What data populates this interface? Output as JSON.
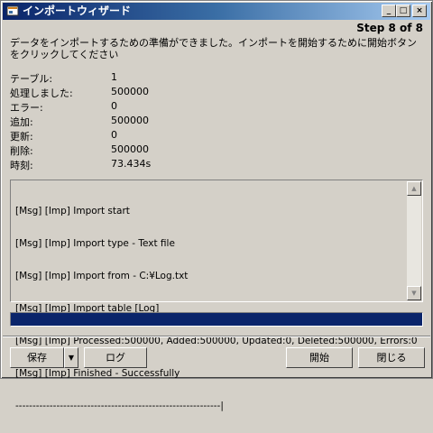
{
  "window": {
    "title": "インポートウィザード",
    "min": "_",
    "max": "□",
    "close": "×"
  },
  "step": "Step 8 of 8",
  "instruction": "データをインポートするための準備ができました。インポートを開始するために開始ボタンをクリックしてください",
  "stats": [
    {
      "label": "テーブル:",
      "value": "1"
    },
    {
      "label": "処理しました:",
      "value": "500000"
    },
    {
      "label": "エラー:",
      "value": "0"
    },
    {
      "label": "追加:",
      "value": "500000"
    },
    {
      "label": "更新:",
      "value": "0"
    },
    {
      "label": "削除:",
      "value": "500000"
    },
    {
      "label": "時刻:",
      "value": "73.434s"
    }
  ],
  "log": [
    "[Msg] [Imp] Import start",
    "[Msg] [Imp] Import type - Text file",
    "[Msg] [Imp] Import from - C:¥Log.txt",
    "[Msg] [Imp] Import table [Log]",
    "[Msg] [Imp] Processed:500000, Added:500000, Updated:0, Deleted:500000, Errors:0",
    "[Msg] [Imp] Finished - Successfully",
    "------------------------------------------------------------|"
  ],
  "progress": 1.0,
  "buttons": {
    "save": "保存",
    "save_arrow": "▼",
    "log": "ログ",
    "start": "開始",
    "close": "閉じる"
  },
  "scroll": {
    "up": "▲",
    "down": "▼"
  }
}
